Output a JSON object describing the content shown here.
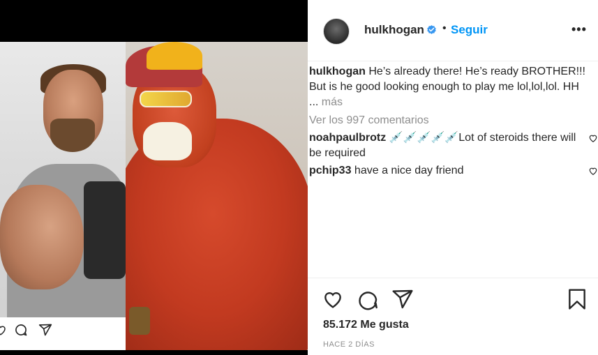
{
  "post": {
    "username": "hulkhogan",
    "separator": "•",
    "follow_label": "Seguir",
    "more_label": "•••"
  },
  "caption": {
    "username": "hulkhogan",
    "text": "He’s already there! He’s ready BROTHER!!! But is he good looking enough to play me lol,lol,lol. HH ...",
    "more_label": "más"
  },
  "view_comments": "Ver los 997 comentarios",
  "comments": [
    {
      "username": "noahpaulbrotz",
      "text": "💉💉💉💉💉Lot of steroids there will be required"
    },
    {
      "username": "pchip33",
      "text": "have a nice day friend"
    }
  ],
  "likes": "85.172 Me gusta",
  "time": "HACE 2 DÍAS",
  "icons": {
    "like": "heart-icon",
    "comment": "comment-icon",
    "share": "share-icon",
    "save": "bookmark-icon",
    "verified": "verified-badge-icon"
  },
  "colors": {
    "link": "#0095f6",
    "muted": "#8e8e8e",
    "verified": "#3897f0"
  }
}
